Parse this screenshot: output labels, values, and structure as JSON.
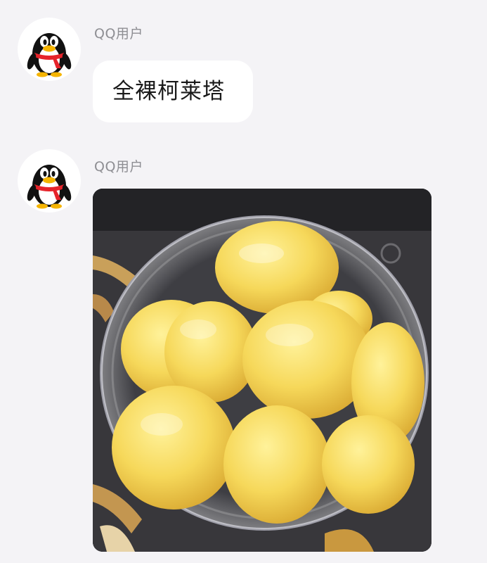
{
  "messages": [
    {
      "sender": "QQ用户",
      "avatar_icon": "qq-penguin-icon",
      "type": "text",
      "text": "全裸柯莱塔"
    },
    {
      "sender": "QQ用户",
      "avatar_icon": "qq-penguin-icon",
      "type": "image",
      "image_content": "peeled-potatoes-in-glass-bowl"
    }
  ],
  "colors": {
    "background": "#f4f3f6",
    "bubble": "#ffffff",
    "sender_name": "#8e8e93",
    "penguin_scarf": "#e6232a",
    "penguin_beak": "#f5b400"
  }
}
